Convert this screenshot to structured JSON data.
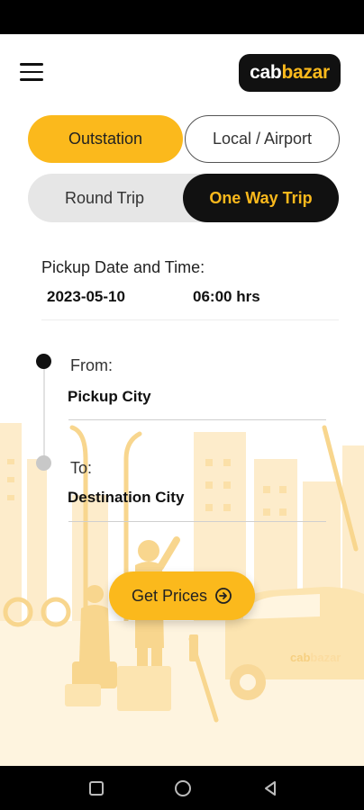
{
  "app": {
    "logo_part1": "cab",
    "logo_part2": "bazar",
    "brand_color": "#fbb91c"
  },
  "tabs": {
    "outstation": "Outstation",
    "local_airport": "Local / Airport",
    "active": "Outstation"
  },
  "trip_type": {
    "round_trip": "Round Trip",
    "one_way": "One Way Trip",
    "active": "One Way Trip"
  },
  "pickup": {
    "label": "Pickup Date and Time:",
    "date": "2023-05-10",
    "time": "06:00 hrs"
  },
  "route": {
    "from_label": "From:",
    "from_value": "Pickup City",
    "to_label": "To:",
    "to_value": "Destination City"
  },
  "actions": {
    "get_prices": "Get Prices"
  },
  "background": {
    "car_logo_part1": "cab",
    "car_logo_part2": "bazar"
  },
  "icons": {
    "menu": "hamburger-menu-icon",
    "arrow": "arrow-right-circle-icon",
    "nav_recent": "square-icon",
    "nav_home": "circle-icon",
    "nav_back": "triangle-back-icon"
  }
}
